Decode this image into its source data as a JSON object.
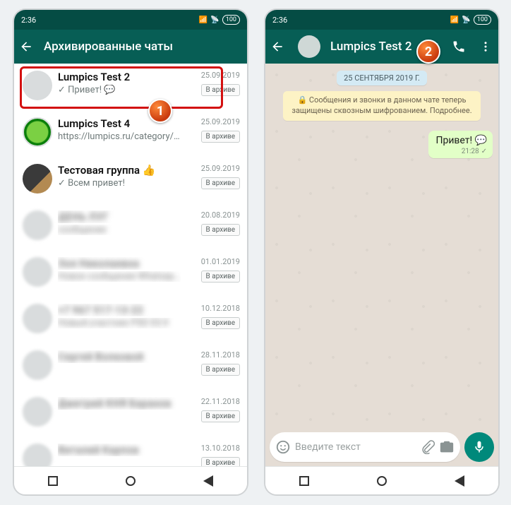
{
  "status": {
    "time": "2:36",
    "battery": "100"
  },
  "left": {
    "title": "Архивированные чаты",
    "archive_label": "В архиве",
    "chats": [
      {
        "name": "Lumpics Test 2",
        "msg": "✓ Привет! 💬",
        "date": "25.09.2019"
      },
      {
        "name": "Lumpics Test 4",
        "msg": "https://lumpics.ru/category/w…",
        "date": "25.09.2019"
      },
      {
        "name": "Тестовая группа 👍",
        "msg": "✓ Всем привет!",
        "date": "25.09.2019"
      },
      {
        "name": "ДЕНЬ ЛУГ",
        "msg": "сообщение",
        "date": "20.08.2019"
      },
      {
        "name": "Зоя Николаевна",
        "msg": "Новое сообщение Whatsapp работа",
        "date": "01.01.2019"
      },
      {
        "name": "+7 967 517-13-22",
        "msg": "Новый участник PSD 03.9",
        "date": "10.12.2018"
      },
      {
        "name": "Сергей Волковой",
        "msg": "",
        "date": "28.11.2018"
      },
      {
        "name": "Дмитрий КНЯ Баранов",
        "msg": "",
        "date": "22.11.2018"
      },
      {
        "name": "Виталий Карпов",
        "msg": "",
        "date": "13.10.2018"
      }
    ]
  },
  "right": {
    "title": "Lumpics Test 2",
    "date_chip": "25 СЕНТЯБРЯ 2019 Г.",
    "encryption": "🔒 Сообщения и звонки в данном чате теперь защищены сквозным шифрованием. Подробнее.",
    "msg_text": "Привет! 💬",
    "msg_time": "21:28",
    "composer_placeholder": "Введите текст"
  },
  "steps": {
    "one": "1",
    "two": "2"
  }
}
